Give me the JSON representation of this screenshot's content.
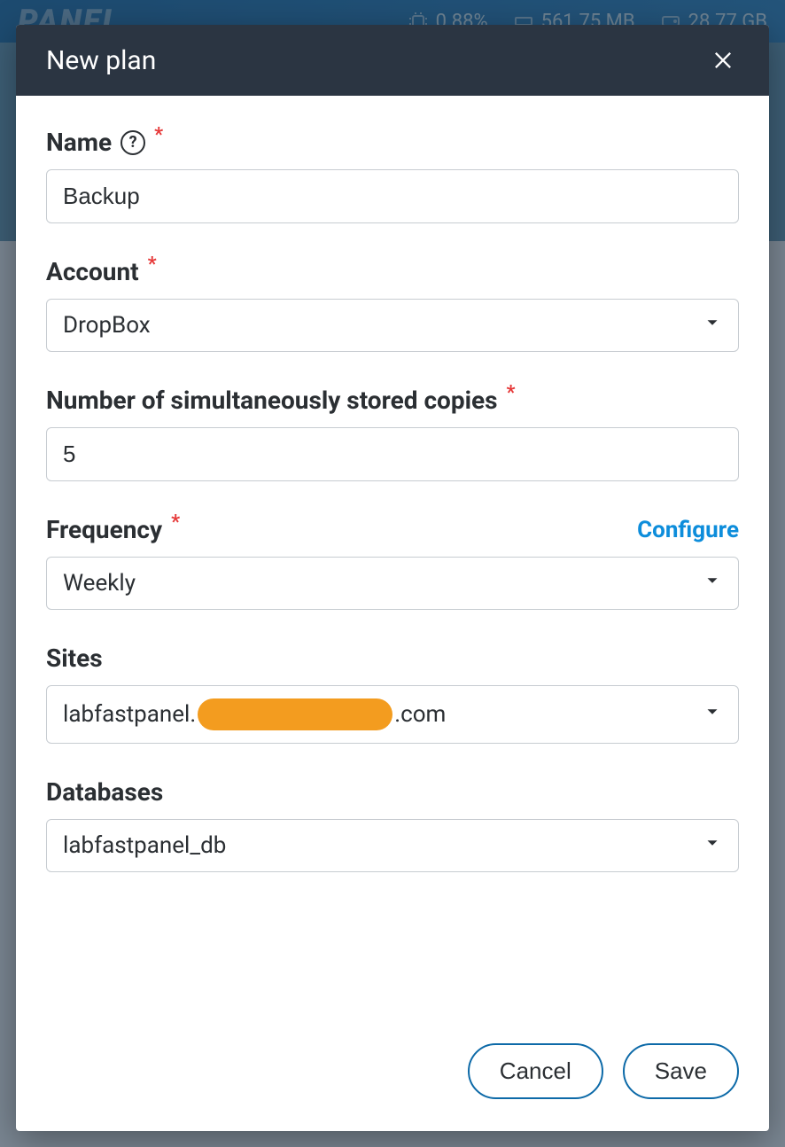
{
  "background": {
    "logo": "PANEL",
    "stats": {
      "cpu": "0.88%",
      "ram": "561.75 MB",
      "disk": "28.77 GB"
    }
  },
  "modal": {
    "title": "New plan",
    "fields": {
      "name": {
        "label": "Name",
        "value": "Backup",
        "required": true,
        "help": "?"
      },
      "account": {
        "label": "Account",
        "value": "DropBox",
        "required": true
      },
      "copies": {
        "label": "Number of simultaneously stored copies",
        "value": "5",
        "required": true
      },
      "frequency": {
        "label": "Frequency",
        "value": "Weekly",
        "required": true,
        "configure": "Configure"
      },
      "sites": {
        "label": "Sites",
        "prefix": "labfastpanel.",
        "suffix": ".com"
      },
      "databases": {
        "label": "Databases",
        "value": "labfastpanel_db"
      }
    },
    "buttons": {
      "cancel": "Cancel",
      "save": "Save"
    }
  }
}
